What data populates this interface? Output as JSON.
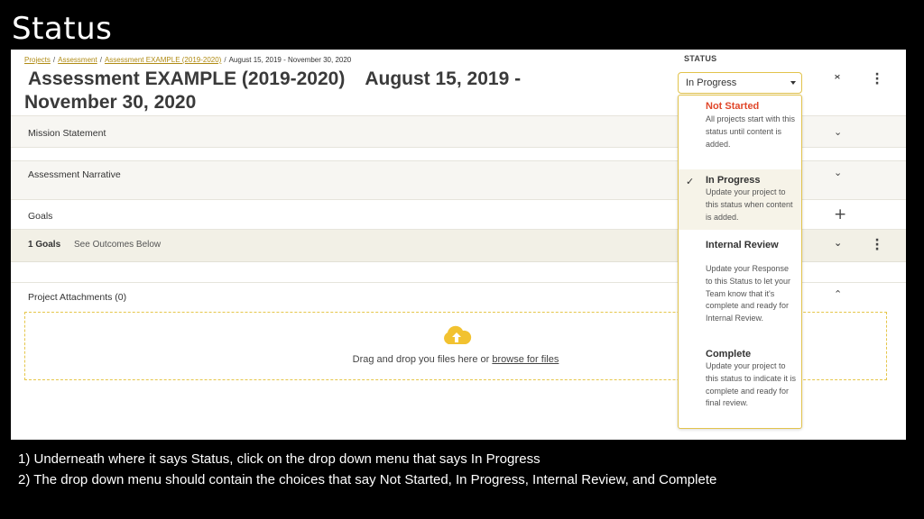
{
  "slide": {
    "title": "Status",
    "caption_lines": [
      "1) Underneath where it says Status, click on the drop down menu that says In Progress",
      "2) The drop down menu should contain the choices that say Not Started, In Progress, Internal Review, and Complete"
    ]
  },
  "breadcrumb": {
    "items": [
      "Projects",
      "Assessment",
      "Assessment EXAMPLE (2019-2020)",
      "August 15, 2019 - November 30, 2020"
    ],
    "separator": "/"
  },
  "page": {
    "title_line1_a": "Assessment EXAMPLE (2019-2020)",
    "title_line1_b": "August 15, 2019 -",
    "title_line2": "November 30, 2020"
  },
  "status": {
    "label": "STATUS",
    "selected": "In Progress",
    "options": [
      {
        "name": "Not Started",
        "description": "All projects start with this status until content is added.",
        "color": "#e0472a"
      },
      {
        "name": "In Progress",
        "description": "Update your project to this status when content is added.",
        "checked": true
      },
      {
        "name": "Internal Review",
        "description": "Update your Response to this Status to let your Team know that it's complete and ready for Internal Review."
      },
      {
        "name": "Complete",
        "description": "Update your project to this status to indicate it is complete and ready for final review."
      }
    ]
  },
  "sections": {
    "mission": "Mission Statement",
    "narrative": "Assessment Narrative",
    "goals": "Goals",
    "goals_count": "1 Goals",
    "goals_link": "See Outcomes Below",
    "attachments": "Project Attachments (0)"
  },
  "dropzone": {
    "text": "Drag and drop you files here or ",
    "link": "browse for files"
  },
  "colors": {
    "accent": "#e2c34c",
    "link": "#b08b14",
    "not_started": "#e0472a",
    "cloud": "#f2c230"
  }
}
